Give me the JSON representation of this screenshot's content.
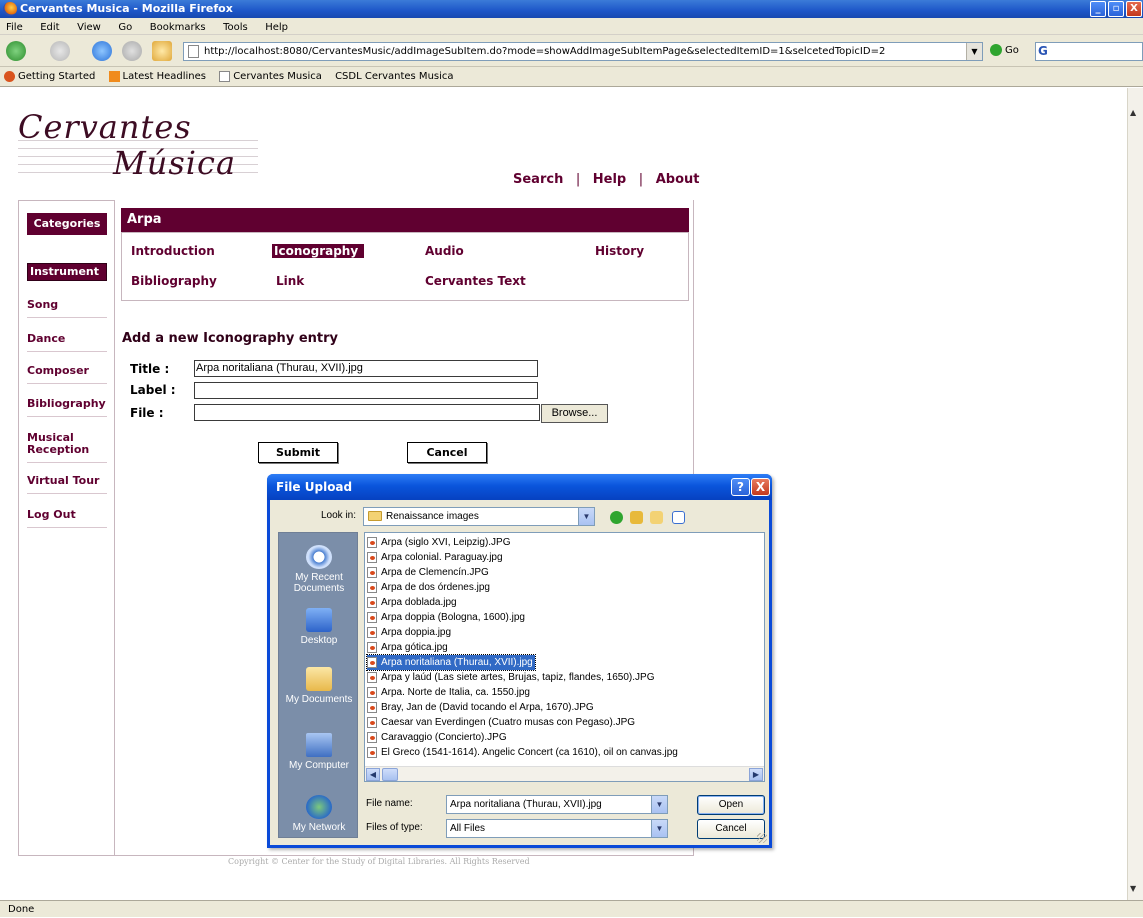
{
  "window": {
    "title": "Cervantes Musica - Mozilla Firefox",
    "controls": [
      "_",
      "▫",
      "X"
    ]
  },
  "menu": [
    "File",
    "Edit",
    "View",
    "Go",
    "Bookmarks",
    "Tools",
    "Help"
  ],
  "nav": {
    "url": "http://localhost:8080/CervantesMusic/addImageSubItem.do?mode=showAddImageSubItemPage&selectedItemID=1&selcetedTopicID=2",
    "go_label": "Go",
    "search_glyph": "G"
  },
  "bookmarks": [
    "Getting Started",
    "Latest Headlines",
    "Cervantes Musica",
    "CSDL Cervantes Musica"
  ],
  "logo": {
    "line1": "Cervantes",
    "line2": "Música"
  },
  "toplinks": {
    "search": "Search",
    "help": "Help",
    "about": "About",
    "sep": "|"
  },
  "sidebar": {
    "header": "Categories",
    "items": [
      {
        "label": "Instrument"
      },
      {
        "label": "Song"
      },
      {
        "label": "Dance"
      },
      {
        "label": "Composer"
      },
      {
        "label": "Bibliography"
      },
      {
        "label": "Musical Reception"
      },
      {
        "label": "Virtual Tour"
      },
      {
        "label": "Log Out"
      }
    ]
  },
  "item": {
    "title": "Arpa",
    "tabs": [
      "Introduction",
      "Iconography",
      "Audio",
      "History",
      "Bibliography",
      "Link",
      "Cervantes Text"
    ]
  },
  "form": {
    "heading": "Add a new Iconography entry",
    "title_label": "Title :",
    "title_value": "Arpa noritaliana (Thurau, XVII).jpg",
    "label_label": "Label :",
    "label_value": "",
    "file_label": "File :",
    "file_value": "",
    "browse": "Browse...",
    "submit": "Submit",
    "cancel": "Cancel"
  },
  "copyright": "Copyright © Center for the Study of Digital Libraries. All Rights Reserved",
  "status": "Done",
  "dialog": {
    "title": "File Upload",
    "help": "?",
    "close": "X",
    "lookin_label": "Look in:",
    "lookin_value": "Renaissance images",
    "places": [
      "My Recent Documents",
      "Desktop",
      "My Documents",
      "My Computer",
      "My Network"
    ],
    "files": [
      "Arpa (siglo XVI, Leipzig).JPG",
      "Arpa colonial. Paraguay.jpg",
      "Arpa de Clemencín.JPG",
      "Arpa de dos órdenes.jpg",
      "Arpa doblada.jpg",
      "Arpa doppia (Bologna, 1600).jpg",
      "Arpa doppia.jpg",
      "Arpa gótica.jpg",
      "Arpa noritaliana (Thurau, XVII).jpg",
      "Arpa y laúd (Las siete artes, Brujas, tapiz, flandes, 1650).JPG",
      "Arpa. Norte de Italia, ca. 1550.jpg",
      "Bray, Jan de (David tocando el Arpa, 1670).JPG",
      "Caesar van Everdingen (Cuatro musas con Pegaso).JPG",
      "Caravaggio (Concierto).JPG",
      "El Greco (1541-1614). Angelic Concert (ca 1610), oil on canvas.jpg"
    ],
    "selected_file": "Arpa noritaliana (Thurau, XVII).jpg",
    "filename_label": "File name:",
    "filename_value": "Arpa noritaliana (Thurau, XVII).jpg",
    "filetype_label": "Files of type:",
    "filetype_value": "All Files",
    "open": "Open",
    "cancel": "Cancel"
  },
  "colors": {
    "brand": "#600030",
    "xp_blue": "#0a55dc",
    "selection": "#316ac5"
  }
}
